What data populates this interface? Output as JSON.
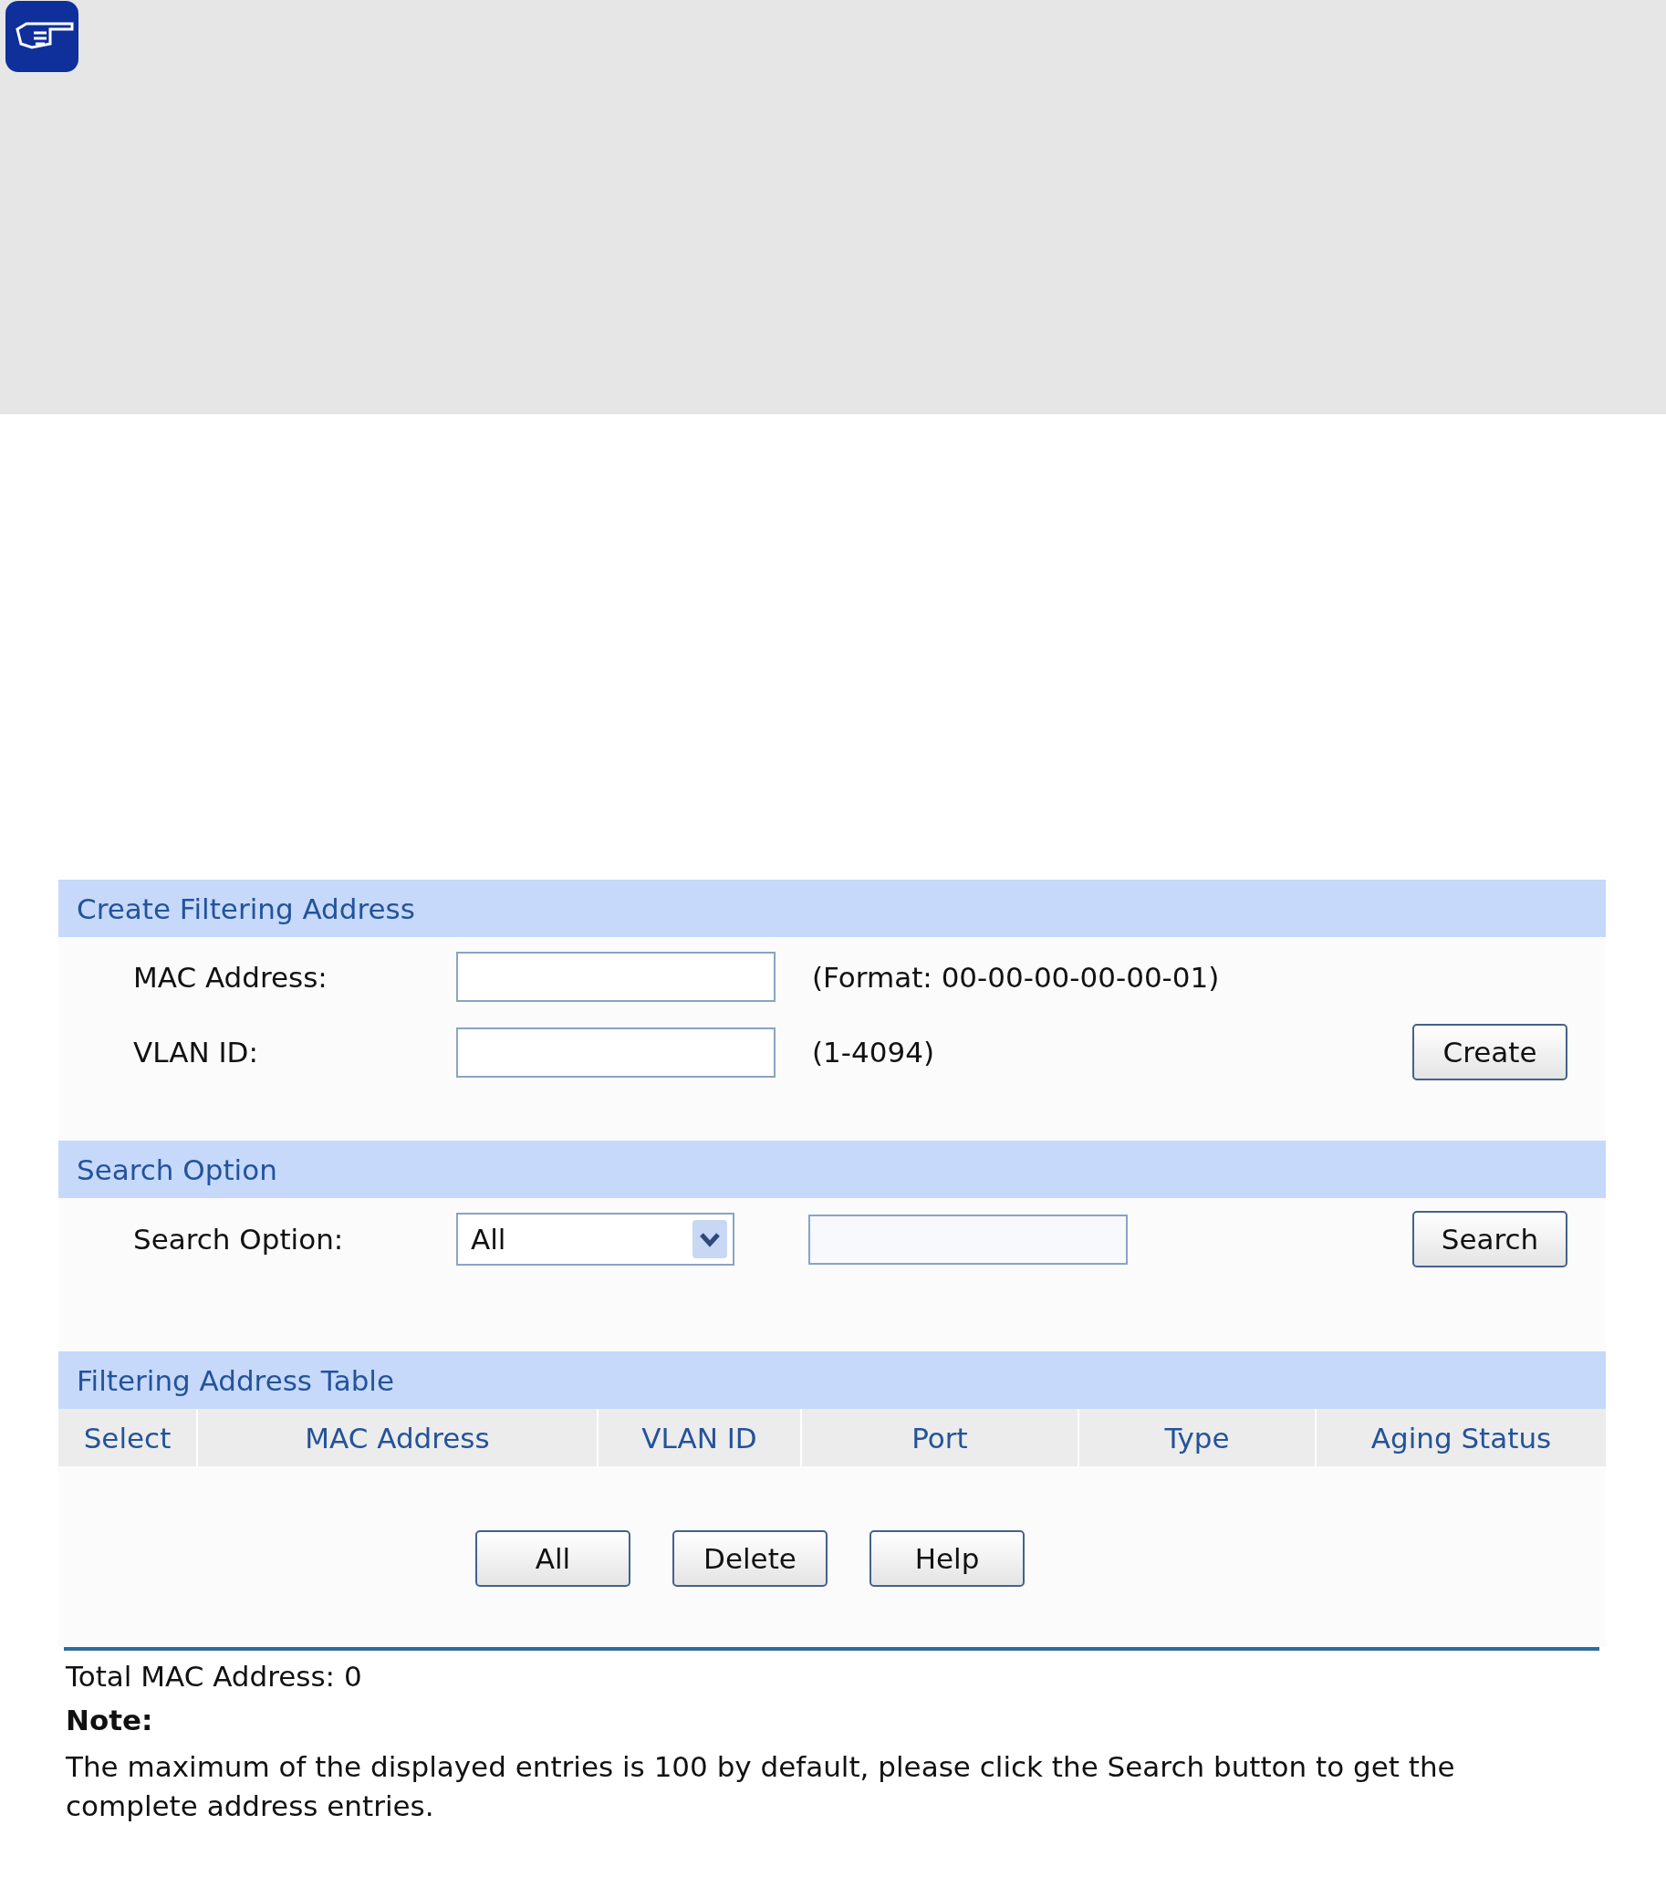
{
  "create_section": {
    "title": "Create Filtering Address",
    "fields": [
      {
        "label": "MAC Address:",
        "hint": "(Format: 00-00-00-00-00-01)"
      },
      {
        "label": "VLAN ID:",
        "hint": "(1-4094)"
      }
    ],
    "button": "Create"
  },
  "search_section": {
    "title": "Search Option",
    "label": "Search Option:",
    "select_value": "All",
    "button": "Search"
  },
  "table": {
    "title": "Filtering Address Table",
    "columns": [
      "Select",
      "MAC Address",
      "VLAN ID",
      "Port",
      "Type",
      "Aging Status"
    ]
  },
  "buttons": [
    "All",
    "Delete",
    "Help"
  ],
  "total": "Total MAC Address: 0",
  "note": {
    "title": "Note:",
    "text": "The maximum of the displayed entries is 100 by default, please click the Search button to get the complete address entries."
  }
}
